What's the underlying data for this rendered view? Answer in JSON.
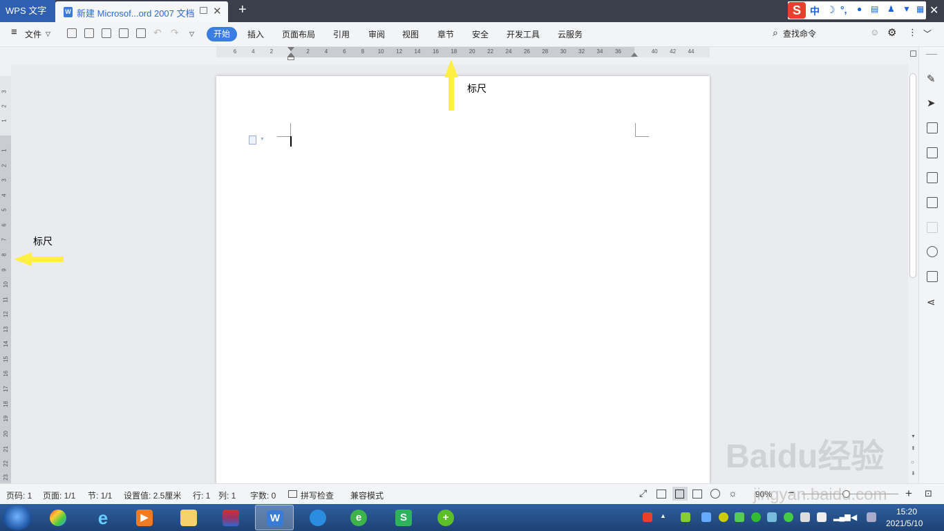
{
  "titlebar": {
    "app_name": "WPS 文字",
    "doc_tab_title": "新建 Microsof...ord 2007 文档",
    "new_tab": "+",
    "close": "✕"
  },
  "ime": {
    "logo": "S",
    "mode": "中",
    "items": [
      "☽",
      "°,",
      "🎤",
      "⌨",
      "👤",
      "👕",
      "▦"
    ]
  },
  "menu": {
    "file": "文件",
    "tabs": [
      "开始",
      "插入",
      "页面布局",
      "引用",
      "审阅",
      "视图",
      "章节",
      "安全",
      "开发工具",
      "云服务"
    ],
    "search": "查找命令"
  },
  "hruler": {
    "numbers": [
      "6",
      "4",
      "2",
      "",
      "2",
      "4",
      "6",
      "8",
      "10",
      "12",
      "14",
      "16",
      "18",
      "20",
      "22",
      "24",
      "26",
      "28",
      "30",
      "32",
      "34",
      "36",
      "",
      "40",
      "42",
      "44"
    ]
  },
  "vruler": {
    "numbers": [
      "3",
      "2",
      "1",
      "1",
      "2",
      "3",
      "4",
      "5",
      "6",
      "7",
      "8",
      "9",
      "10",
      "11",
      "12",
      "13",
      "14",
      "15",
      "16",
      "17",
      "18",
      "19",
      "20",
      "21",
      "22",
      "23"
    ]
  },
  "annotations": {
    "top_label": "标尺",
    "left_label": "标尺",
    "arrow_color": "#ffee44"
  },
  "status": {
    "page_num": "页码: 1",
    "pages": "页面: 1/1",
    "section": "节: 1/1",
    "setting": "设置值: 2.5厘米",
    "row": "行: 1",
    "col": "列: 1",
    "words": "字数: 0",
    "spell": "拼写检查",
    "compat": "兼容模式",
    "zoom": "90%"
  },
  "taskbar": {
    "time": "15:20",
    "date": "2021/5/10"
  },
  "watermark": {
    "brand": "Baidu经验",
    "url": "jingyan.baidu.com"
  },
  "colors": {
    "accent": "#3a7de0",
    "titlebar": "#3a3f4b",
    "app_tab": "#2f5fb0"
  }
}
